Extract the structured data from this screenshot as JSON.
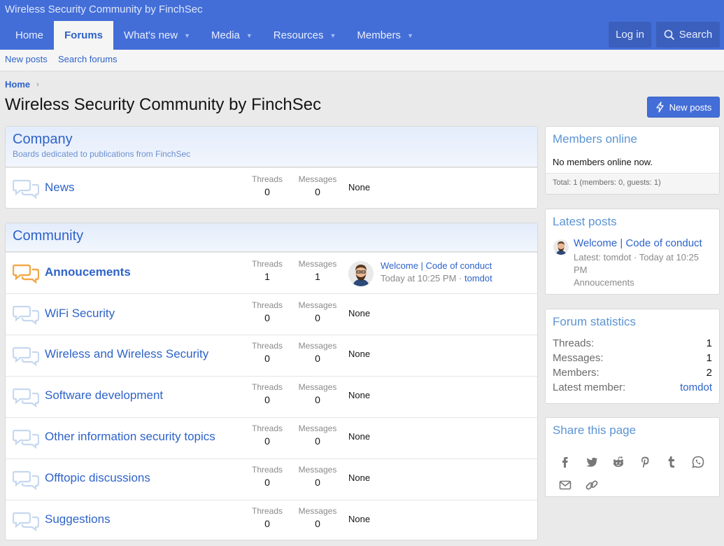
{
  "header": {
    "site_title": "Wireless Security Community by FinchSec",
    "nav": [
      {
        "label": "Home"
      },
      {
        "label": "Forums"
      },
      {
        "label": "What's new"
      },
      {
        "label": "Media"
      },
      {
        "label": "Resources"
      },
      {
        "label": "Members"
      }
    ],
    "login_label": "Log in",
    "search_label": "Search"
  },
  "subnav": {
    "new_posts": "New posts",
    "search_forums": "Search forums"
  },
  "breadcrumb": {
    "home": "Home"
  },
  "page": {
    "title": "Wireless Security Community by FinchSec",
    "new_posts_button": "New posts"
  },
  "labels": {
    "threads": "Threads",
    "messages": "Messages",
    "none": "None"
  },
  "categories": [
    {
      "title": "Company",
      "description": "Boards dedicated to publications from FinchSec",
      "nodes": [
        {
          "title": "News",
          "threads": "0",
          "messages": "0",
          "unread": false
        }
      ]
    },
    {
      "title": "Community",
      "nodes": [
        {
          "title": "Annoucements",
          "threads": "1",
          "messages": "1",
          "unread": true,
          "last_post": {
            "title": "Welcome | Code of conduct",
            "time": "Today at 10:25 PM",
            "sep": "·",
            "user": "tomdot"
          }
        },
        {
          "title": "WiFi Security",
          "threads": "0",
          "messages": "0",
          "unread": false
        },
        {
          "title": "Wireless and Wireless Security",
          "threads": "0",
          "messages": "0",
          "unread": false
        },
        {
          "title": "Software development",
          "threads": "0",
          "messages": "0",
          "unread": false
        },
        {
          "title": "Other information security topics",
          "threads": "0",
          "messages": "0",
          "unread": false
        },
        {
          "title": "Offtopic discussions",
          "threads": "0",
          "messages": "0",
          "unread": false
        },
        {
          "title": "Suggestions",
          "threads": "0",
          "messages": "0",
          "unread": false
        }
      ]
    }
  ],
  "sidebar": {
    "members_online": {
      "title": "Members online",
      "text": "No members online now.",
      "footer": "Total: 1 (members: 0, guests: 1)"
    },
    "latest_posts": {
      "title": "Latest posts",
      "post_title": "Welcome | Code of conduct",
      "meta_line1": "Latest: tomdot · Today at 10:25",
      "meta_line2": "PM",
      "forum": "Annoucements"
    },
    "forum_statistics": {
      "title": "Forum statistics",
      "rows": [
        {
          "label": "Threads:",
          "value": "1"
        },
        {
          "label": "Messages:",
          "value": "1"
        },
        {
          "label": "Members:",
          "value": "2"
        },
        {
          "label": "Latest member:",
          "value": "tomdot"
        }
      ]
    },
    "share": {
      "title": "Share this page",
      "icons": [
        "facebook-icon",
        "twitter-icon",
        "reddit-icon",
        "pinterest-icon",
        "tumblr-icon",
        "whatsapp-icon",
        "email-icon",
        "link-icon"
      ]
    }
  },
  "colors": {
    "brand": "#436ed8",
    "link": "#2e63c9",
    "unread_icon": "#f0a94a",
    "read_icon": "#c6d8ef"
  }
}
